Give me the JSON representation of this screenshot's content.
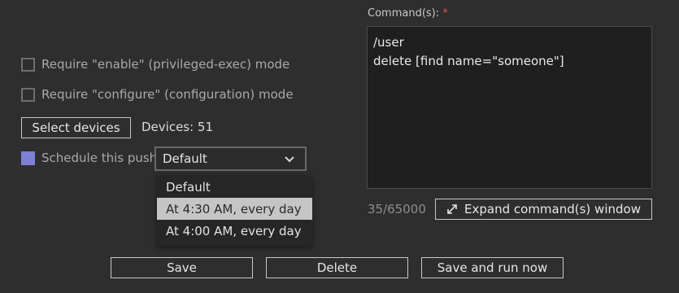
{
  "options": {
    "enable_label": "Require \"enable\" (privileged-exec) mode",
    "configure_label": "Require \"configure\" (configuration) mode",
    "select_devices_label": "Select devices",
    "devices_text": "Devices: 51",
    "schedule_label": "Schedule this push"
  },
  "schedule": {
    "selected": "Default",
    "options": [
      "Default",
      "At 4:30 AM, every day",
      "At 4:00 AM, every day"
    ],
    "highlighted_index": 1
  },
  "command": {
    "label": "Command(s):",
    "required_marker": "*",
    "lines": [
      "/user",
      "delete [find name=\"someone\"]"
    ],
    "char_count": "35/65000",
    "expand_label": "Expand command(s) window"
  },
  "actions": {
    "save": "Save",
    "delete": "Delete",
    "save_run": "Save and run now"
  },
  "colors": {
    "background": "#2e2e2e",
    "checkbox_checked": "#7c80d6",
    "required": "#e05050"
  }
}
